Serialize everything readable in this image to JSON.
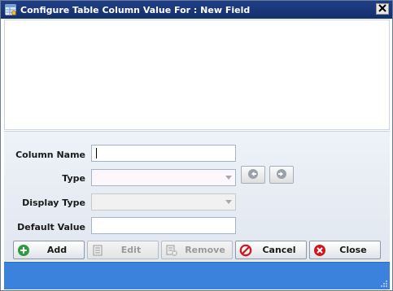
{
  "window": {
    "title": "Configure Table Column Value For : New Field",
    "close_label": "✕"
  },
  "form": {
    "column_name": {
      "label": "Column Name",
      "value": ""
    },
    "type": {
      "label": "Type",
      "value": ""
    },
    "display_type": {
      "label": "Display Type",
      "value": ""
    },
    "default_value": {
      "label": "Default Value",
      "value": ""
    }
  },
  "buttons": {
    "add": "Add",
    "edit": "Edit",
    "remove": "Remove",
    "cancel": "Cancel",
    "close": "Close"
  },
  "icons": {
    "title": "table-config-icon",
    "add": "plus-circle-icon",
    "edit": "edit-icon",
    "remove": "remove-icon",
    "cancel": "no-entry-icon",
    "close": "x-circle-icon",
    "prev": "arrow-left-icon",
    "next": "arrow-right-icon"
  },
  "colors": {
    "titlebar": "#1f3f86",
    "statusbar": "#3a82dc",
    "add_icon": "#2e9c3e",
    "cancel_icon": "#d0161c",
    "close_icon": "#d0161c"
  }
}
